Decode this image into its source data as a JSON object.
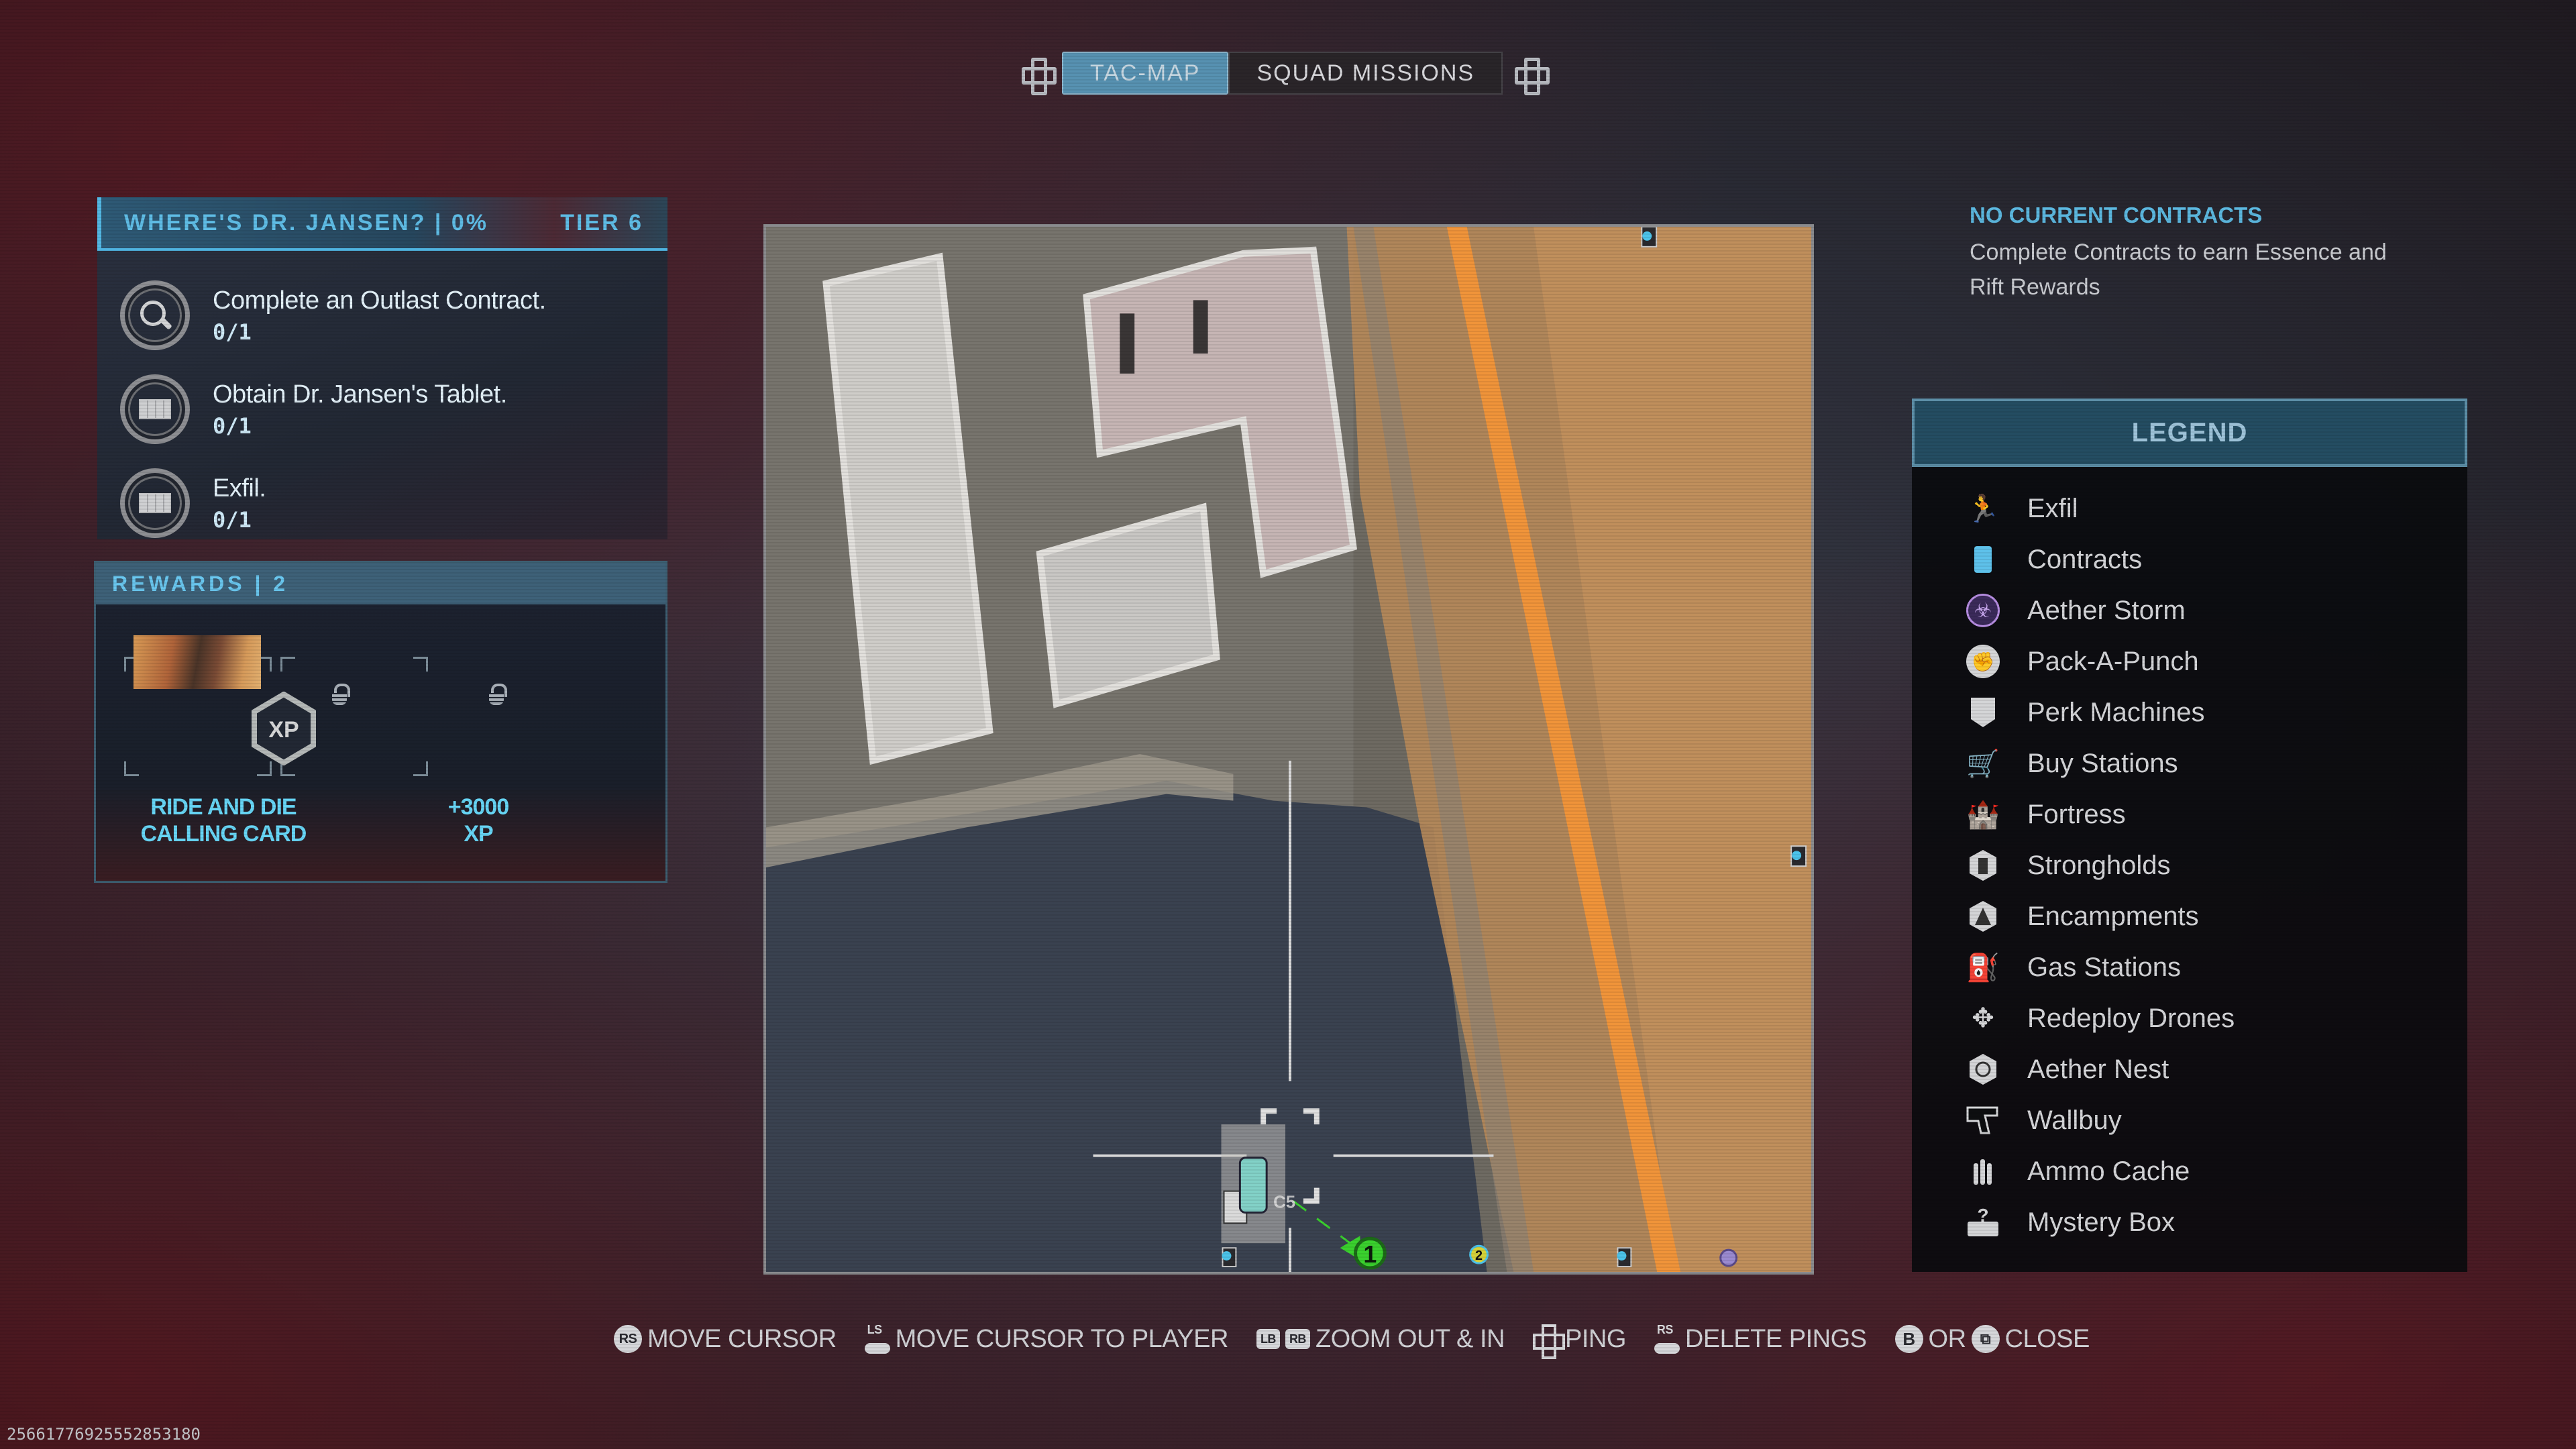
{
  "tabs": [
    {
      "label": "TAC-MAP",
      "active": true
    },
    {
      "label": "SQUAD MISSIONS",
      "active": false
    }
  ],
  "mission": {
    "title": "WHERE'S DR. JANSEN? | 0%",
    "tier": "TIER 6",
    "progress_percent": 0,
    "objectives": [
      {
        "icon": "magnifier-icon",
        "title": "Complete an Outlast Contract.",
        "progress": "0/1"
      },
      {
        "icon": "crate-icon",
        "title": "Obtain Dr. Jansen's Tablet.",
        "progress": "0/1"
      },
      {
        "icon": "crate-icon",
        "title": "Exfil.",
        "progress": "0/1"
      }
    ]
  },
  "rewards": {
    "title": "REWARDS | 2",
    "items": [
      {
        "label_line1": "RIDE AND DIE",
        "label_line2": "CALLING CARD",
        "locked": true,
        "type": "calling-card"
      },
      {
        "label_line1": "+3000",
        "label_line2": "XP",
        "locked": true,
        "type": "xp",
        "badge_text": "XP"
      }
    ]
  },
  "map": {
    "player_marker_number": "1",
    "squad_marker_number": "2",
    "cursor_grid_label": "C5"
  },
  "contracts": {
    "heading": "NO CURRENT CONTRACTS",
    "description": "Complete Contracts to earn Essence and Rift Rewards"
  },
  "legend": {
    "title": "LEGEND",
    "items": [
      {
        "icon": "exfil-icon",
        "label": "Exfil",
        "color": "#4cc3ea"
      },
      {
        "icon": "contracts-icon",
        "label": "Contracts",
        "color": "#5ec1ea"
      },
      {
        "icon": "aether-storm-icon",
        "label": "Aether Storm",
        "color": "#b58ce0"
      },
      {
        "icon": "pack-a-punch-icon",
        "label": "Pack-A-Punch",
        "color": "#d4d5d7"
      },
      {
        "icon": "perk-machine-icon",
        "label": "Perk Machines",
        "color": "#d4d5d7"
      },
      {
        "icon": "buy-station-icon",
        "label": "Buy Stations",
        "color": "#d4d5d7"
      },
      {
        "icon": "fortress-icon",
        "label": "Fortress",
        "color": "#d4d5d7"
      },
      {
        "icon": "stronghold-icon",
        "label": "Strongholds",
        "color": "#d4d5d7"
      },
      {
        "icon": "encampment-icon",
        "label": "Encampments",
        "color": "#d4d5d7"
      },
      {
        "icon": "gas-station-icon",
        "label": "Gas Stations",
        "color": "#d4d5d7"
      },
      {
        "icon": "redeploy-drone-icon",
        "label": "Redeploy Drones",
        "color": "#d4d5d7"
      },
      {
        "icon": "aether-nest-icon",
        "label": "Aether Nest",
        "color": "#d4d5d7"
      },
      {
        "icon": "wallbuy-icon",
        "label": "Wallbuy",
        "color": "#d4d5d7"
      },
      {
        "icon": "ammo-cache-icon",
        "label": "Ammo Cache",
        "color": "#d4d5d7"
      },
      {
        "icon": "mystery-box-icon",
        "label": "Mystery Box",
        "color": "#d4d5d7"
      }
    ]
  },
  "controls": [
    {
      "button": "RS",
      "label": "MOVE CURSOR"
    },
    {
      "button": "LS",
      "label": "MOVE CURSOR TO PLAYER"
    },
    {
      "button": "LB",
      "button2": "RB",
      "label": "ZOOM OUT & IN"
    },
    {
      "button": "dpad-up",
      "label": "PING"
    },
    {
      "button": "RS",
      "label": "DELETE PINGS"
    },
    {
      "button": "B",
      "joiner": "OR",
      "button2": "view",
      "label": "CLOSE"
    }
  ],
  "build_id": "25661776925552853180",
  "colors": {
    "accent": "#5fbde6",
    "tab_active": "#5791b1",
    "reward_text": "#67d6f6",
    "zone_orange": "#f0943a",
    "path_green": "#33cc33"
  }
}
